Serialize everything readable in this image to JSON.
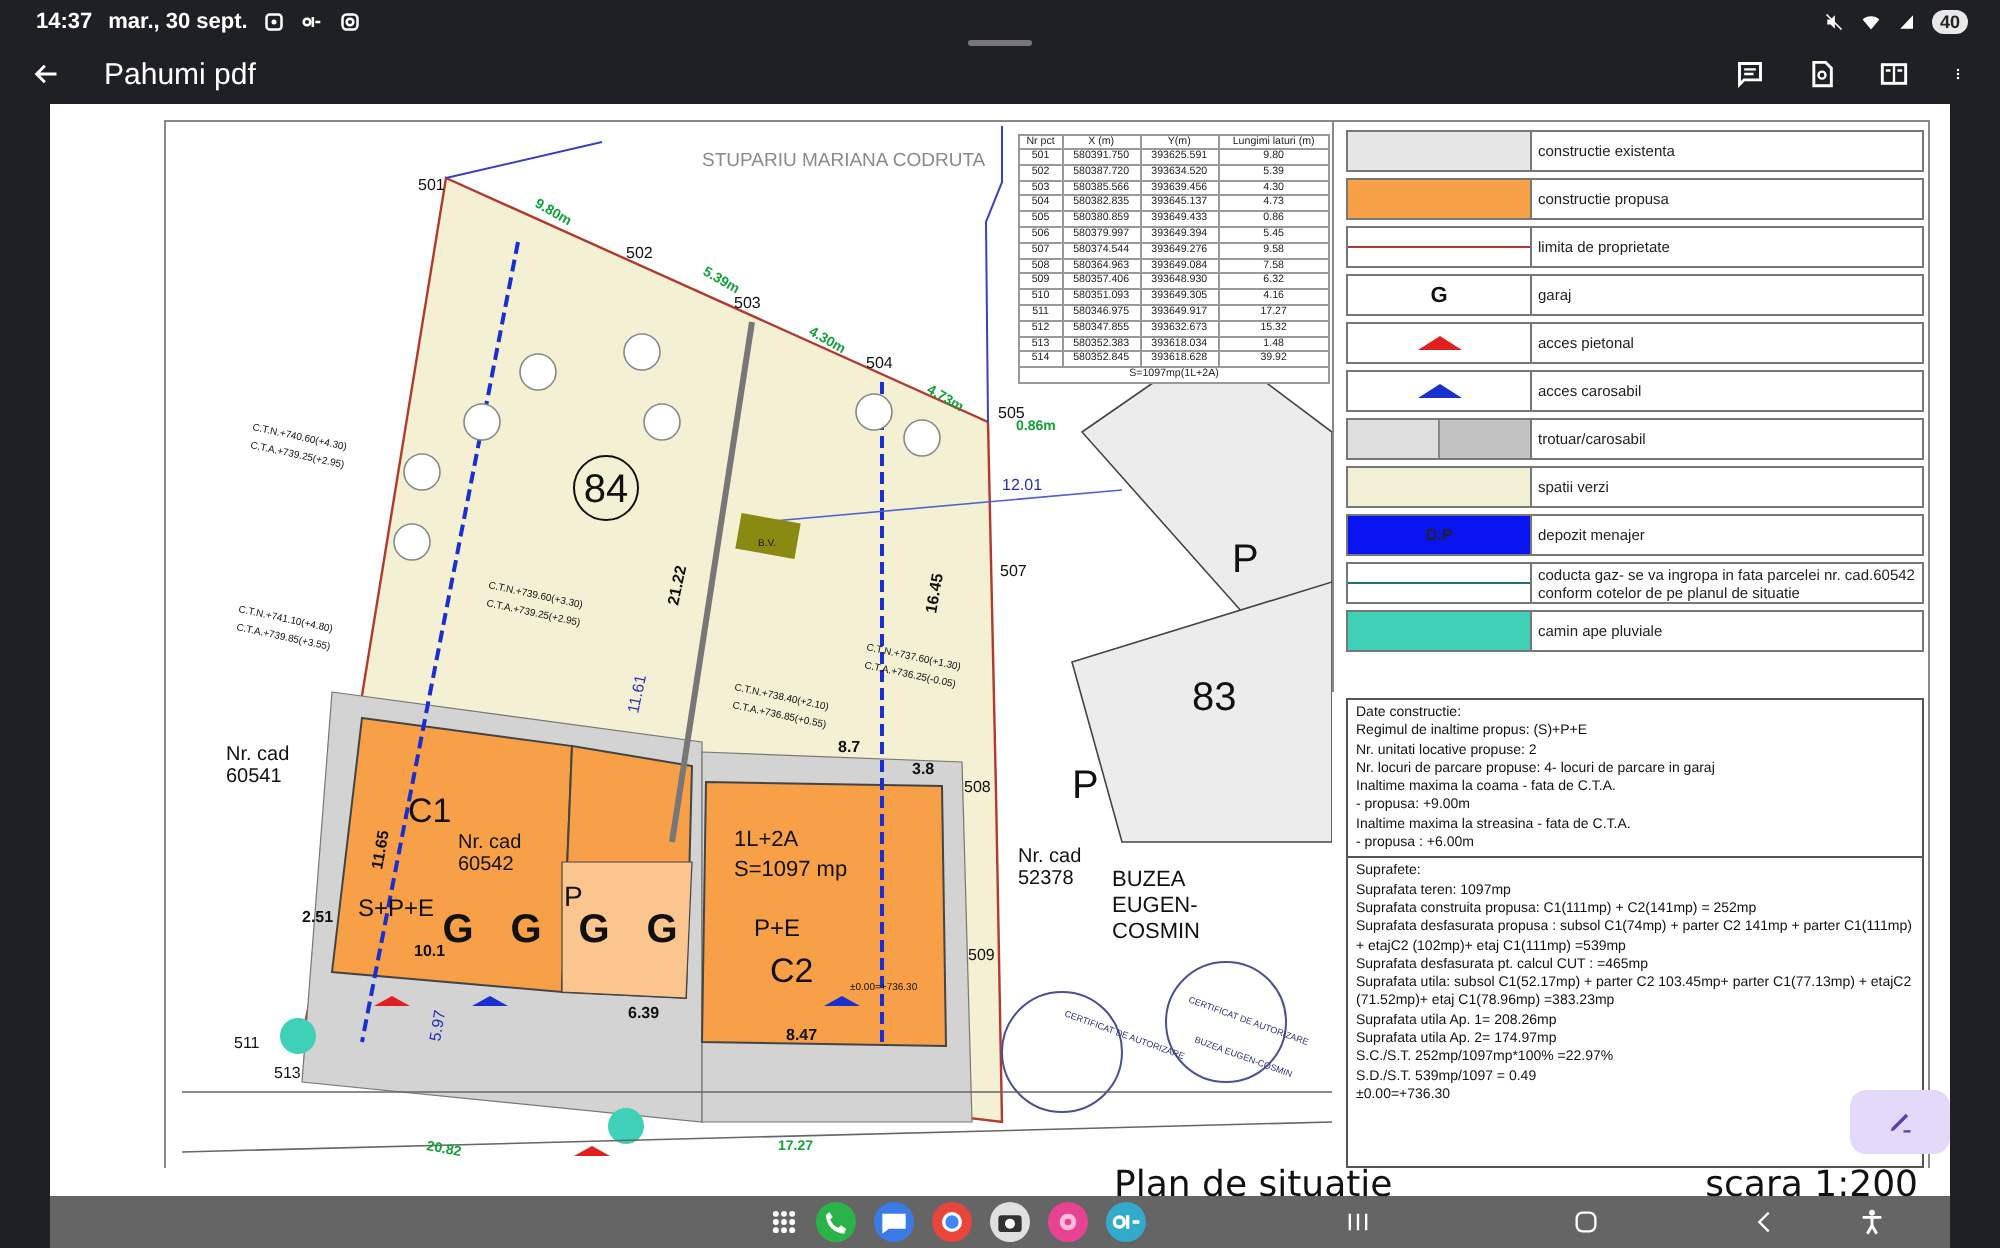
{
  "status_bar": {
    "time": "14:37",
    "date": "mar., 30 sept.",
    "battery": "40"
  },
  "app_bar": {
    "title": "Pahumi pdf"
  },
  "plan": {
    "labels": [
      {
        "text": "STUPARIU MARIANA CODRUTA",
        "kind": "owner"
      },
      {
        "text": "501",
        "kind": "point"
      },
      {
        "text": "502",
        "kind": "point"
      },
      {
        "text": "503",
        "kind": "point"
      },
      {
        "text": "504",
        "kind": "point"
      },
      {
        "text": "505",
        "kind": "point"
      },
      {
        "text": "507",
        "kind": "point"
      },
      {
        "text": "508",
        "kind": "point"
      },
      {
        "text": "509",
        "kind": "point"
      },
      {
        "text": "511",
        "kind": "point"
      },
      {
        "text": "513",
        "kind": "point"
      },
      {
        "text": "9.80m",
        "kind": "boundary"
      },
      {
        "text": "5.39m",
        "kind": "boundary"
      },
      {
        "text": "4.30m",
        "kind": "boundary"
      },
      {
        "text": "4.73m",
        "kind": "boundary"
      },
      {
        "text": "0.86m",
        "kind": "boundary"
      },
      {
        "text": "12.01",
        "kind": "distance"
      },
      {
        "text": "21.22",
        "kind": "dimension"
      },
      {
        "text": "11.61",
        "kind": "distance"
      },
      {
        "text": "16.45",
        "kind": "dimension"
      },
      {
        "text": "84",
        "kind": "lot"
      },
      {
        "text": "83",
        "kind": "big"
      },
      {
        "text": "P",
        "kind": "big"
      },
      {
        "text": "P",
        "kind": "big"
      },
      {
        "text": "Nr. cad",
        "kind": "cad"
      },
      {
        "text": "60541",
        "kind": "cad"
      },
      {
        "text": "C1",
        "kind": "building"
      },
      {
        "text": "Nr. cad",
        "kind": "cad"
      },
      {
        "text": "60542",
        "kind": "cad"
      },
      {
        "text": "S+P+E",
        "kind": "building"
      },
      {
        "text": "G",
        "kind": "garage"
      },
      {
        "text": "G",
        "kind": "garage"
      },
      {
        "text": "G",
        "kind": "garage"
      },
      {
        "text": "G",
        "kind": "garage"
      },
      {
        "text": "P",
        "kind": "building"
      },
      {
        "text": "10.1",
        "kind": "dimension"
      },
      {
        "text": "6.39",
        "kind": "dimension"
      },
      {
        "text": "1L+2A",
        "kind": "building"
      },
      {
        "text": "S=1097 mp",
        "kind": "building"
      },
      {
        "text": "P+E",
        "kind": "building"
      },
      {
        "text": "C2",
        "kind": "building"
      },
      {
        "text": "±0.00=+736.30",
        "kind": "elevation"
      },
      {
        "text": "8.47",
        "kind": "dimension"
      },
      {
        "text": "8.7",
        "kind": "dimension"
      },
      {
        "text": "3.8",
        "kind": "dimension"
      },
      {
        "text": "Nr. cad",
        "kind": "cad"
      },
      {
        "text": "52378",
        "kind": "cad"
      },
      {
        "text": "BUZEA",
        "kind": "neighbour"
      },
      {
        "text": "EUGEN-",
        "kind": "neighbour"
      },
      {
        "text": "COSMIN",
        "kind": "neighbour"
      },
      {
        "text": "B.V.",
        "kind": "elevation"
      },
      {
        "text": "11.65",
        "kind": "dimension"
      },
      {
        "text": "2.51",
        "kind": "dimension"
      },
      {
        "text": "5.97",
        "kind": "distance"
      },
      {
        "text": "20.82",
        "kind": "boundary"
      },
      {
        "text": "17.27",
        "kind": "boundary"
      },
      {
        "text": "C.T.N.+740.60(+4.30)",
        "kind": "elevation"
      },
      {
        "text": "C.T.A.+739.25(+2.95)",
        "kind": "elevation"
      },
      {
        "text": "C.T.N.+741.10(+4.80)",
        "kind": "elevation"
      },
      {
        "text": "C.T.A.+739.85(+3.55)",
        "kind": "elevation"
      },
      {
        "text": "C.T.N.+739.60(+3.30)",
        "kind": "elevation"
      },
      {
        "text": "C.T.A.+739.25(+2.95)",
        "kind": "elevation"
      },
      {
        "text": "C.T.N.+737.60(+1.30)",
        "kind": "elevation"
      },
      {
        "text": "C.T.A.+736.25(-0.05)",
        "kind": "elevation"
      },
      {
        "text": "C.T.N.+738.40(+2.10)",
        "kind": "elevation"
      },
      {
        "text": "C.T.A.+736.85(+0.55)",
        "kind": "elevation"
      },
      {
        "text": "CERTIFICAT DE AUTORIZARE",
        "kind": "stamp"
      },
      {
        "text": "CERTIFICAT DE AUTORIZARE",
        "kind": "stamp"
      },
      {
        "text": "BUZEA EUGEN-COSMIN",
        "kind": "stamp"
      }
    ]
  },
  "coordinate_table": {
    "columns": [
      "Nr pct",
      "X (m)",
      "Y(m)",
      "Lungimi laturi (m)"
    ],
    "rows": [
      [
        "501",
        "580391.750",
        "393625.591",
        "9.80"
      ],
      [
        "502",
        "580387.720",
        "393634.520",
        "5.39"
      ],
      [
        "503",
        "580385.566",
        "393639.456",
        "4.30"
      ],
      [
        "504",
        "580382.835",
        "393645.137",
        "4.73"
      ],
      [
        "505",
        "580380.859",
        "393649.433",
        "0.86"
      ],
      [
        "506",
        "580379.997",
        "393649.394",
        "5.45"
      ],
      [
        "507",
        "580374.544",
        "393649.276",
        "9.58"
      ],
      [
        "508",
        "580364.963",
        "393649.084",
        "7.58"
      ],
      [
        "509",
        "580357.406",
        "393648.930",
        "6.32"
      ],
      [
        "510",
        "580351.093",
        "393649.305",
        "4.16"
      ],
      [
        "511",
        "580346.975",
        "393649.917",
        "17.27"
      ],
      [
        "512",
        "580347.855",
        "393632.673",
        "15.32"
      ],
      [
        "513",
        "580352.383",
        "393618.034",
        "1.48"
      ],
      [
        "514",
        "580352.845",
        "393618.628",
        "39.92"
      ]
    ],
    "total": "S=1097mp(1L+2A)"
  },
  "legend": [
    {
      "kind": "fill",
      "color": "#e6e6e6",
      "label": "constructie existenta"
    },
    {
      "kind": "fill",
      "color": "#f7a048",
      "label": "constructie propusa"
    },
    {
      "kind": "line",
      "color": "#b03a2e",
      "label": "limita de proprietate"
    },
    {
      "kind": "letter",
      "symbol": "G",
      "label": "garaj"
    },
    {
      "kind": "arrow",
      "color": "#e02020",
      "label": "acces pietonal"
    },
    {
      "kind": "arrow",
      "color": "#1a2fd0",
      "label": "acces carosabil"
    },
    {
      "kind": "split",
      "color": "#dedede",
      "label": "trotuar/carosabil"
    },
    {
      "kind": "fill",
      "color": "#f2f0d4",
      "label": "spatii verzi"
    },
    {
      "kind": "symbol_fill",
      "color": "#0a14f0",
      "symbol": "D.P",
      "label": "depozit menajer"
    },
    {
      "kind": "line",
      "color": "#1d6f78",
      "label": "coducta gaz- se va ingropa in fata parcelei nr. cad.60542 conform cotelor de pe planul de situatie"
    },
    {
      "kind": "fill",
      "color": "#3ed1b8",
      "label": "camin ape pluviale"
    }
  ],
  "construction_data": [
    "Date constructie:",
    "Regimul de inaltime propus: (S)+P+E",
    "Nr. unitati locative  propuse: 2",
    "Nr. locuri de parcare propuse: 4- locuri de parcare in garaj",
    "Inaltime maxima la coama - fata de C.T.A.",
    "- propusa:  +9.00m",
    "Inaltime maxima la streasina - fata de C.T.A.",
    "- propusa :  +6.00m"
  ],
  "surfaces": [
    "Suprafete:",
    "Suprafata teren: 1097mp",
    "Suprafata construita propusa: C1(111mp) + C2(141mp) = 252mp",
    "Suprafata desfasurata propusa : subsol C1(74mp) +  parter C2 141mp + parter C1(111mp) + etajC2 (102mp)+  etaj C1(111mp) =539mp",
    "Suprafata desfasurata pt. calcul CUT : =465mp",
    "Suprafata utila: subsol C1(52.17mp) + parter C2 103.45mp+ parter C1(77.13mp)  + etajC2 (71.52mp)+ etaj C1(78.96mp) =383.23mp",
    "Suprafata utila Ap. 1= 208.26mp",
    "Suprafata utila Ap. 2= 174.97mp",
    "S.C./S.T. 252mp/1097mp*100% =22.97%",
    "S.D./S.T. 539mp/1097 = 0.49",
    "±0.00=+736.30"
  ],
  "drawing_title": "Plan de situatie",
  "scale": "scara 1:200"
}
